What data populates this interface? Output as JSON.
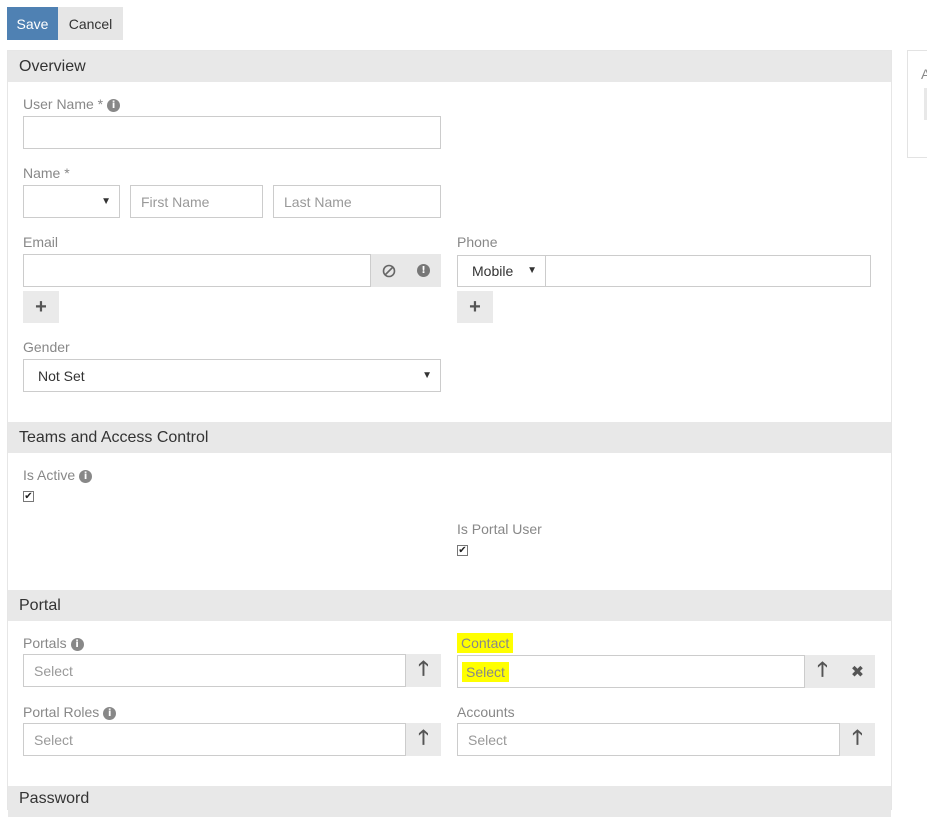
{
  "toolbar": {
    "save_label": "Save",
    "cancel_label": "Cancel"
  },
  "right_panel": {
    "label_fragment": "A"
  },
  "sections": {
    "overview": "Overview",
    "teams": "Teams and Access Control",
    "portal": "Portal",
    "password": "Password"
  },
  "overview": {
    "user_name_label": "User Name *",
    "user_name_value": "",
    "name_label": "Name *",
    "salutation_value": "",
    "first_name_placeholder": "First Name",
    "last_name_placeholder": "Last Name",
    "email_label": "Email",
    "email_value": "",
    "phone_label": "Phone",
    "phone_type": "Mobile",
    "phone_value": "",
    "gender_label": "Gender",
    "gender_value": "Not Set"
  },
  "teams": {
    "is_active_label": "Is Active",
    "is_active_checked": true,
    "is_portal_user_label": "Is Portal User",
    "is_portal_user_checked": true
  },
  "portal": {
    "portals_label": "Portals",
    "portals_placeholder": "Select",
    "contact_label": "Contact",
    "contact_placeholder": "Select",
    "portal_roles_label": "Portal Roles",
    "portal_roles_placeholder": "Select",
    "accounts_label": "Accounts",
    "accounts_placeholder": "Select"
  },
  "icons": {
    "info": "info-icon",
    "plus": "plus-icon",
    "up_arrow": "arrow-up-icon",
    "close": "close-icon",
    "block": "ban-icon",
    "caret": "caret-down-icon"
  },
  "colors": {
    "primary": "#4f81b3",
    "highlight": "#ffff00",
    "header_bg": "#e8e8e8"
  }
}
